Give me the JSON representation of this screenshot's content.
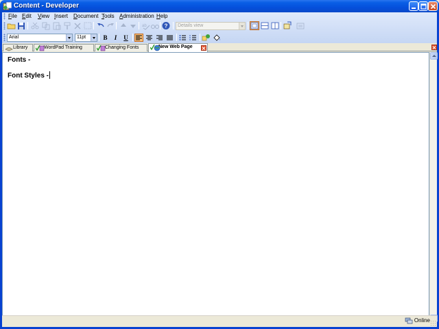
{
  "window": {
    "title": "Content - Developer"
  },
  "menu": {
    "items": [
      {
        "label": "File",
        "key": "F",
        "rest": "ile"
      },
      {
        "label": "Edit",
        "key": "E",
        "rest": "dit"
      },
      {
        "label": "View",
        "key": "V",
        "rest": "iew"
      },
      {
        "label": "Insert",
        "key": "I",
        "rest": "nsert"
      },
      {
        "label": "Document",
        "key": "D",
        "rest": "ocument"
      },
      {
        "label": "Tools",
        "key": "T",
        "rest": "ools"
      },
      {
        "label": "Administration",
        "key": "A",
        "rest": "dministration"
      },
      {
        "label": "Help",
        "key": "H",
        "rest": "elp"
      }
    ]
  },
  "toolbar": {
    "view_combo": "Details view"
  },
  "format": {
    "font_family": "Arial",
    "font_size": "11pt",
    "bold": "B",
    "italic": "I",
    "underline": "U"
  },
  "tabs": [
    {
      "label": "Library",
      "icon": "library-icon"
    },
    {
      "label": "WordPad Training",
      "icon": "check-document-icon"
    },
    {
      "label": "Changing Fonts",
      "icon": "check-document-icon"
    },
    {
      "label": "New Web Page",
      "icon": "check-globe-icon",
      "active": true
    }
  ],
  "document": {
    "line1": "Fonts -",
    "line2": "Font Styles -"
  },
  "status": {
    "connection": "Online"
  },
  "colors": {
    "titlebar": "#0550dc",
    "active_button": "#f7c27f",
    "close_red": "#e2552d"
  }
}
